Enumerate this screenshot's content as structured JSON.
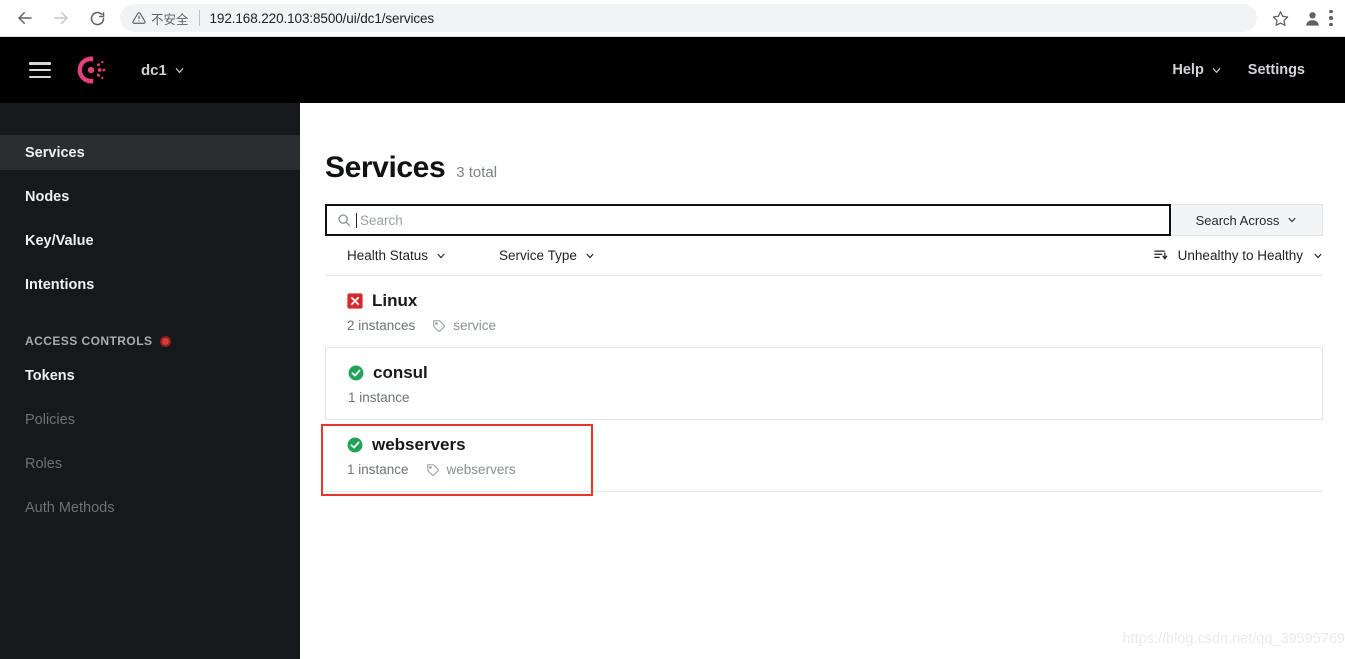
{
  "browser": {
    "back_icon": "back-arrow-icon",
    "forward_icon": "forward-arrow-icon",
    "reload_icon": "reload-icon",
    "security_label": "不安全",
    "url": "192.168.220.103:8500/ui/dc1/services",
    "bookmark_icon": "star-icon",
    "profile_icon": "profile-avatar-icon",
    "menu_icon": "three-dot-menu-icon"
  },
  "topnav": {
    "menu_icon": "hamburger-menu-icon",
    "logo_icon": "consul-logo-icon",
    "datacenter": "dc1",
    "help_label": "Help",
    "settings_label": "Settings",
    "logo_color": "#e0407b"
  },
  "sidebar": {
    "items": [
      {
        "label": "Services",
        "state": "active"
      },
      {
        "label": "Nodes",
        "state": "normal"
      },
      {
        "label": "Key/Value",
        "state": "normal"
      },
      {
        "label": "Intentions",
        "state": "normal"
      }
    ],
    "section_label": "ACCESS CONTROLS",
    "section_badge_color": "#d93b3b",
    "acl_items": [
      {
        "label": "Tokens",
        "state": "normal"
      },
      {
        "label": "Policies",
        "state": "muted"
      },
      {
        "label": "Roles",
        "state": "muted"
      },
      {
        "label": "Auth Methods",
        "state": "muted"
      }
    ]
  },
  "main": {
    "title": "Services",
    "total": "3 total",
    "search": {
      "placeholder": "Search",
      "value": "",
      "icon": "search-icon"
    },
    "search_across_label": "Search Across",
    "filters": [
      {
        "label": "Health Status"
      },
      {
        "label": "Service Type"
      }
    ],
    "sort": {
      "icon": "sort-descending-icon",
      "label": "Unhealthy to Healthy"
    },
    "services": [
      {
        "name": "Linux",
        "status": "unhealthy",
        "status_icon": "x-square-icon",
        "instances": "2 instances",
        "tag": "service",
        "tag_icon": "tag-icon",
        "highlighted": false
      },
      {
        "name": "consul",
        "status": "healthy",
        "status_icon": "check-circle-icon",
        "instances": "1 instance",
        "tag": "",
        "tag_icon": "",
        "highlighted": false
      },
      {
        "name": "webservers",
        "status": "healthy",
        "status_icon": "check-circle-icon",
        "instances": "1 instance",
        "tag": "webservers",
        "tag_icon": "tag-icon",
        "highlighted": true
      }
    ],
    "highlight_color": "#e8342a",
    "healthy_color": "#23a357",
    "unhealthy_color": "#d52b2b"
  },
  "watermark": "https://blog.csdn.net/qq_39595769"
}
